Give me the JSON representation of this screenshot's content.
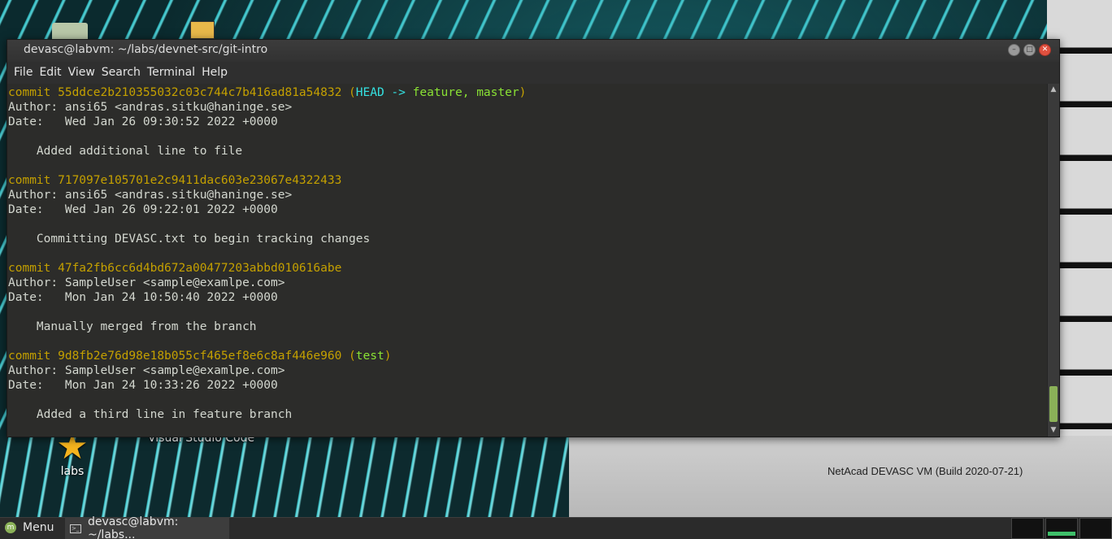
{
  "window": {
    "title": "devasc@labvm: ~/labs/devnet-src/git-intro",
    "controls": [
      "minimize",
      "maximize",
      "close"
    ]
  },
  "menubar": [
    "File",
    "Edit",
    "View",
    "Search",
    "Terminal",
    "Help"
  ],
  "terminal": {
    "commits": [
      {
        "hash_line": "commit 55ddce2b210355032c03c744c7b416ad81a54832",
        "refs_open": "(",
        "refs_head": "HEAD -> ",
        "refs_branches": "feature, master",
        "refs_close": ")",
        "author": "Author: ansi65 <andras.sitku@haninge.se>",
        "date": "Date:   Wed Jan 26 09:30:52 2022 +0000",
        "message": "    Added additional line to file"
      },
      {
        "hash_line": "commit 717097e105701e2c9411dac603e23067e4322433",
        "author": "Author: ansi65 <andras.sitku@haninge.se>",
        "date": "Date:   Wed Jan 26 09:22:01 2022 +0000",
        "message": "    Committing DEVASC.txt to begin tracking changes"
      },
      {
        "hash_line": "commit 47fa2fb6cc6d4bd672a00477203abbd010616abe",
        "author": "Author: SampleUser <sample@examlpe.com>",
        "date": "Date:   Mon Jan 24 10:50:40 2022 +0000",
        "message": "    Manually merged from the branch"
      },
      {
        "hash_line": "commit 9d8fb2e76d98e18b055cf465ef8e6c8af446e960",
        "refs_open": "(",
        "refs_branches": "test",
        "refs_close": ")",
        "author": "Author: SampleUser <sample@examlpe.com>",
        "date": "Date:   Mon Jan 24 10:33:26 2022 +0000",
        "message": "    Added a third line in feature branch"
      }
    ],
    "prompt": ":"
  },
  "desktop": {
    "icons": [
      "labs",
      "Visual Studio Code"
    ],
    "vm_label": "NetAcad DEVASC VM (Build 2020-07-21)"
  },
  "taskbar": {
    "menu_label": "Menu",
    "task_label": "devasc@labvm: ~/labs..."
  },
  "colors": {
    "commit_hash": "#c4a000",
    "head_ref": "#34e2e2",
    "branch_ref": "#8ae234",
    "terminal_bg": "#2c2c2a",
    "scroll_thumb": "#8bb158"
  }
}
